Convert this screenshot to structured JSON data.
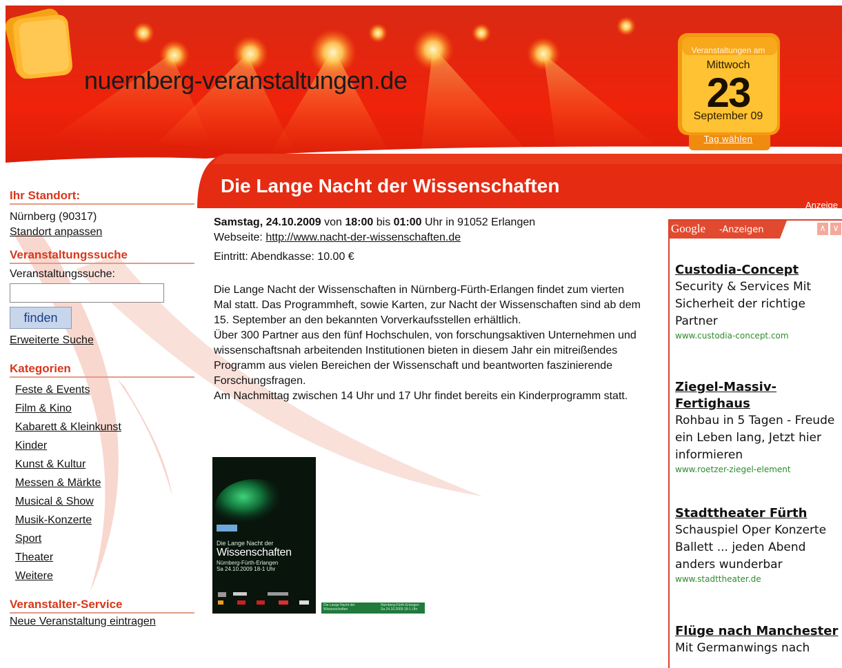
{
  "header": {
    "site_name": "nuernberg-veranstaltungen.de",
    "event_title": "Die Lange Nacht der Wissenschaften",
    "ad_label": "Anzeige"
  },
  "date_widget": {
    "label": "Veranstaltungen am",
    "weekday": "Mittwoch",
    "day": "23",
    "month": "September 09",
    "choose_day": "Tag wählen"
  },
  "sidebar": {
    "location_heading": "Ihr Standort:",
    "location_value": "Nürnberg (90317)",
    "location_change": "Standort anpassen",
    "search_heading": "Veranstaltungssuche",
    "search_label": "Veranstaltungssuche:",
    "search_value": "",
    "search_button": "finden",
    "advanced_search": "Erweiterte Suche",
    "categories_heading": "Kategorien",
    "categories": [
      "Feste & Events",
      "Film & Kino",
      "Kabarett & Kleinkunst",
      "Kinder",
      "Kunst & Kultur",
      "Messen & Märkte",
      "Musical & Show",
      "Musik-Konzerte",
      "Sport",
      "Theater",
      "Weitere"
    ],
    "organizer_heading": "Veranstalter-Service",
    "organizer_link": "Neue Veranstaltung eintragen"
  },
  "event": {
    "date": "Samstag, 24.10.2009",
    "from_word": "von",
    "start": "18:00",
    "to_word": "bis",
    "end": "01:00",
    "location": "Uhr in 91052 Erlangen",
    "website_label": "Webseite:",
    "website_url": "http://www.nacht-der-wissenschaften.de",
    "admission": "Eintritt: Abendkasse: 10.00 €",
    "description": [
      "Die Lange Nacht der Wissenschaften in Nürnberg-Fürth-Erlangen findet zum vierten Mal statt. Das Programmheft, sowie Karten, zur Nacht der Wissenschaften sind ab dem 15. September an den bekannten Vorverkaufsstellen erhältlich.",
      "Über 300 Partner aus den fünf Hochschulen, von forschungsaktiven Unternehmen und wissenschaftsnah arbeitenden Institutionen bieten in diesem Jahr ein mitreißendes Programm aus vielen Bereichen der Wissenschaft und beantworten faszinierende Forschungsfragen.",
      "Am Nachmittag zwischen 14 Uhr und 17 Uhr findet bereits ein Kinderprogramm statt."
    ],
    "poster": {
      "line1": "Die Lange Nacht der",
      "line2": "Wissenschaften",
      "line3": "Nürnberg-Fürth-Erlangen",
      "line4": "Sa 24.10.2009  18-1 Uhr"
    },
    "banner": {
      "left": "Die Lange Nacht der Wissenschaften",
      "right": "Nürnberg-Fürth-Erlangen Sa 24.10.2009 18-1 Uhr"
    }
  },
  "ads": {
    "brand": "Google",
    "label": "-Anzeigen",
    "prev_icon": "chevron-up-icon",
    "next_icon": "chevron-down-icon",
    "items": [
      {
        "title": "Custodia-Concept",
        "text": "Security & Services Mit Sicherheit der richtige Partner",
        "url": "www.custodia-concept.com"
      },
      {
        "title": "Ziegel-Massiv-Fertighaus",
        "text": "Rohbau in 5 Tagen - Freude ein Leben lang, Jetzt hier informieren",
        "url": "www.roetzer-ziegel-element"
      },
      {
        "title": "Stadttheater Fürth",
        "text": "Schauspiel Oper Konzerte Ballett ... jeden Abend anders wunderbar",
        "url": "www.stadttheater.de"
      },
      {
        "title": "Flüge nach Manchester",
        "text": "Mit Germanwings nach",
        "url": ""
      }
    ]
  },
  "colors": {
    "accent_red": "#d8371b",
    "header_red": "#e52b12",
    "date_orange": "#f7a81b",
    "ad_url_green": "#2e8b2e"
  }
}
